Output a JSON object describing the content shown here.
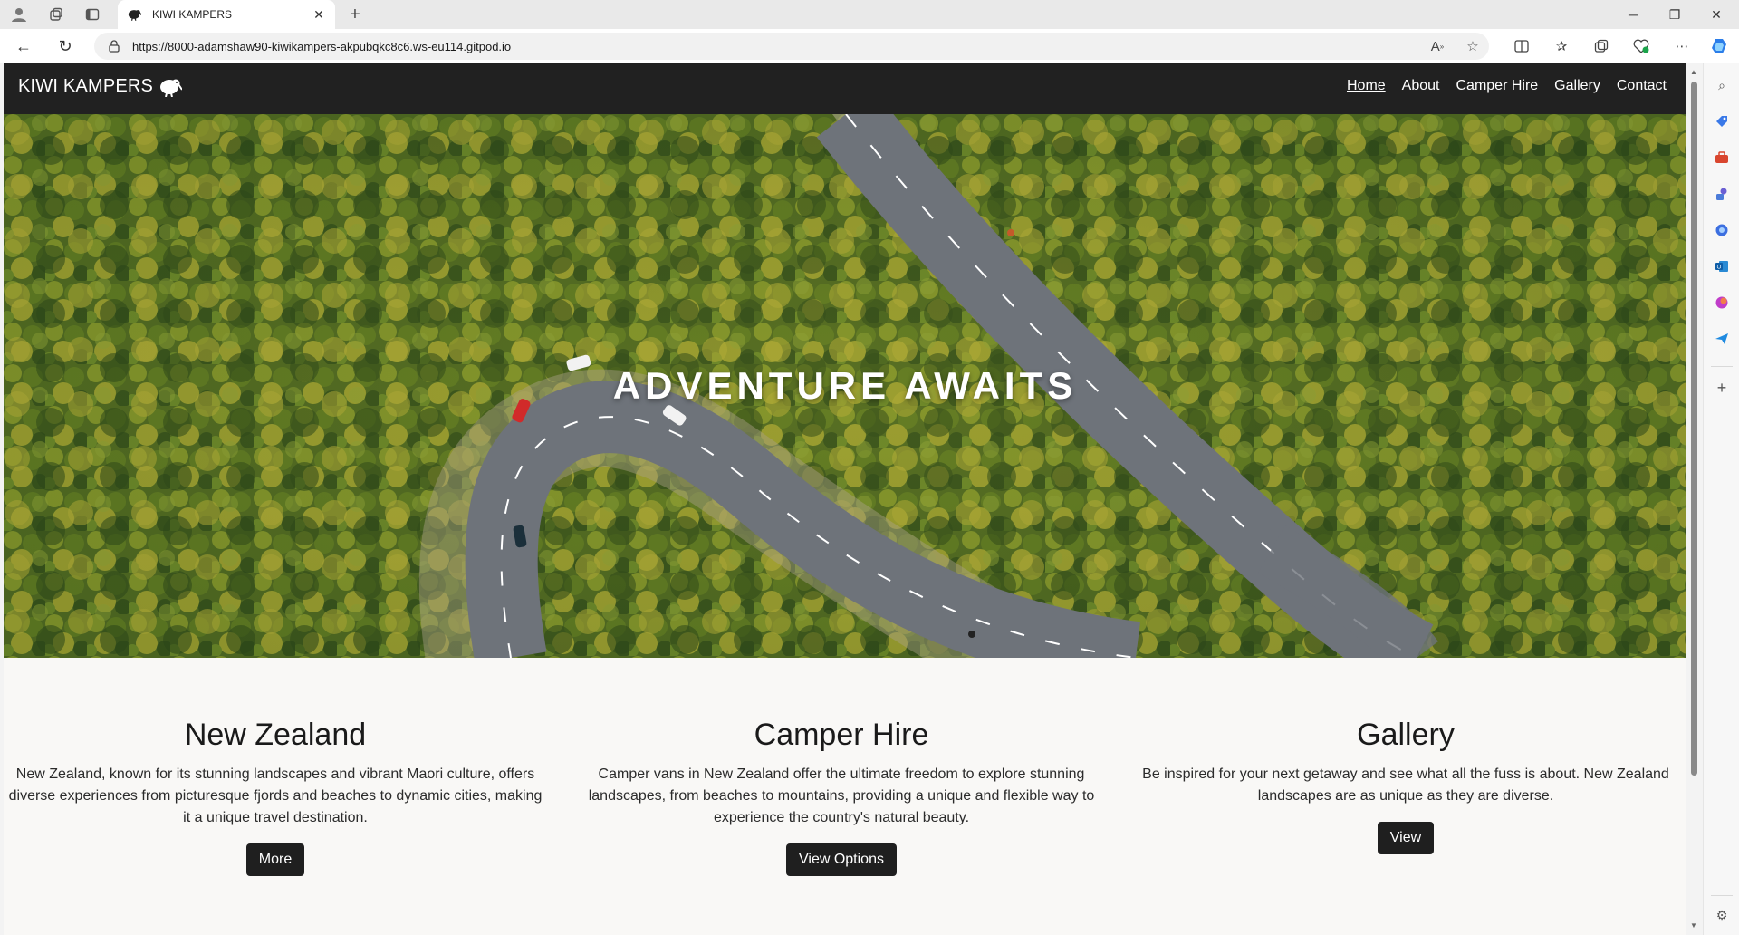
{
  "browser": {
    "tab_title": "KIWI KAMPERS",
    "url": "https://8000-adamshaw90-kiwikampers-akpubqkc8c6.ws-eu114.gitpod.io"
  },
  "site": {
    "brand": "KIWI KAMPERS",
    "brand_icon": "kiwi-bird-icon",
    "nav": [
      {
        "label": "Home",
        "active": true
      },
      {
        "label": "About",
        "active": false
      },
      {
        "label": "Camper Hire",
        "active": false
      },
      {
        "label": "Gallery",
        "active": false
      },
      {
        "label": "Contact",
        "active": false
      }
    ]
  },
  "hero": {
    "title": "ADVENTURE AWAITS",
    "image": "aerial winding road through forest"
  },
  "cards": [
    {
      "title": "New Zealand",
      "text": "New Zealand, known for its stunning landscapes and vibrant Maori culture, offers diverse experiences from picturesque fjords and beaches to dynamic cities, making it a unique travel destination.",
      "button": "More"
    },
    {
      "title": "Camper Hire",
      "text": "Camper vans in New Zealand offer the ultimate freedom to explore stunning landscapes, from beaches to mountains, providing a unique and flexible way to experience the country's natural beauty.",
      "button": "View Options"
    },
    {
      "title": "Gallery",
      "text": "Be inspired for your next getaway and see what all the fuss is about. New Zealand landscapes are as unique as they are diverse.",
      "button": "View"
    }
  ],
  "colors": {
    "navbar": "#212121",
    "page_bg": "#f9f8f6",
    "button_bg": "#1f1f1f"
  }
}
